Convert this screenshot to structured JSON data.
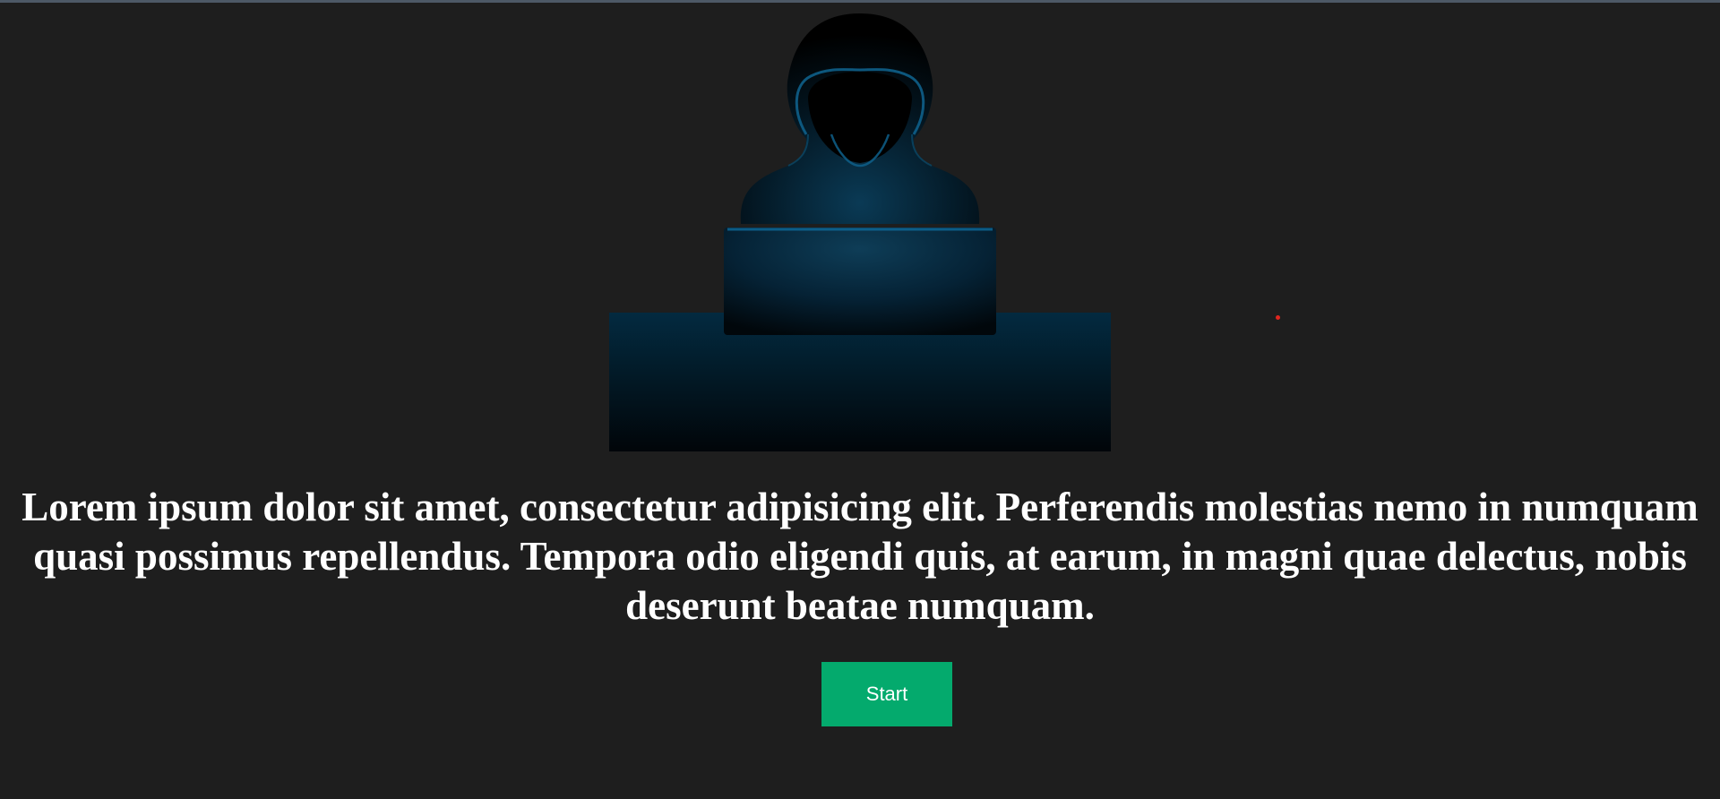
{
  "hero": {
    "image_icon": "hooded-hacker-with-laptop-illustration"
  },
  "headline": {
    "text": "Lorem ipsum dolor sit amet, consectetur adipisicing elit. Perferendis molestias nemo in numquam quasi possimus repellendus. Tempora odio eligendi quis, at earum, in magni quae delectus, nobis deserunt beatae numquam."
  },
  "start_button": {
    "label": "Start"
  },
  "colors": {
    "background": "#1e1e1e",
    "text": "#ffffff",
    "button": "#04aa6d",
    "accent_glow": "#0e6a9a",
    "red_dot": "#e0261f"
  }
}
